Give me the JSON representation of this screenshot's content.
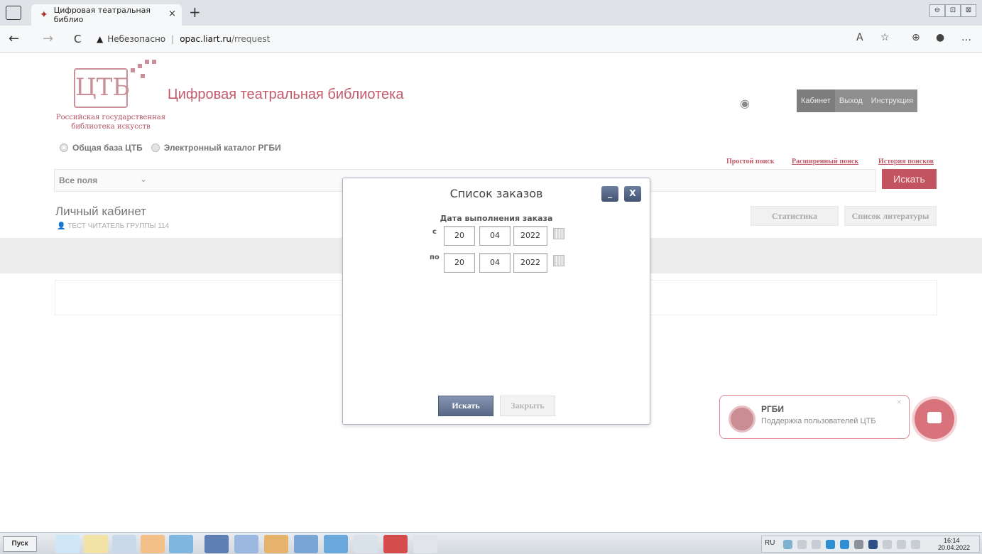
{
  "browser": {
    "tab_title": "Цифровая театральная библио",
    "tab_close": "×",
    "new_tab": "+",
    "url_warning": "Небезопасно",
    "url_host": "opac.liart.ru",
    "url_path": "/rrequest",
    "nav_back": "←",
    "nav_forward": "→",
    "nav_reload": "C",
    "window_controls": [
      "⊖",
      "⊡",
      "⊠"
    ]
  },
  "header": {
    "logo_text": "ЦТБ",
    "logo_sub1": "Российская государственная",
    "logo_sub2": "библиотека искусств",
    "site_title": "Цифровая театральная библиотека",
    "eye_icon": "eye-icon",
    "nav": [
      "Кабинет",
      "Выход",
      "Инструкция"
    ]
  },
  "search": {
    "databases": [
      "Общая база ЦТБ",
      "Электронный каталог РГБИ"
    ],
    "links": [
      "Простой поиск",
      "Расширенный поиск",
      "История поисков"
    ],
    "field_select": "Все поля",
    "search_button": "Искать"
  },
  "cabinet": {
    "title": "Личный кабинет",
    "reader": "ТЕСТ ЧИТАТЕЛЬ ГРУППЫ 114",
    "tabs": [
      "Статистика",
      "Список литературы"
    ]
  },
  "modal": {
    "title": "Список заказов",
    "minimize": "_",
    "close": "X",
    "date_label": "Дата выполнения заказа",
    "from_label": "с",
    "to_label": "по",
    "from": {
      "day": "20",
      "month": "04",
      "year": "2022"
    },
    "to": {
      "day": "20",
      "month": "04",
      "year": "2022"
    },
    "search_button": "Искать",
    "close_button": "Закрыть"
  },
  "chat": {
    "name": "РГБИ",
    "subtitle": "Поддержка пользователей ЦТБ",
    "close": "×"
  },
  "taskbar": {
    "start": "Пуск",
    "lang": "RU",
    "time": "16:14",
    "date": "20.04.2022"
  },
  "colors": {
    "brand": "#c25a6a",
    "modal_button": "#576784",
    "chat_accent": "#d8737c"
  }
}
